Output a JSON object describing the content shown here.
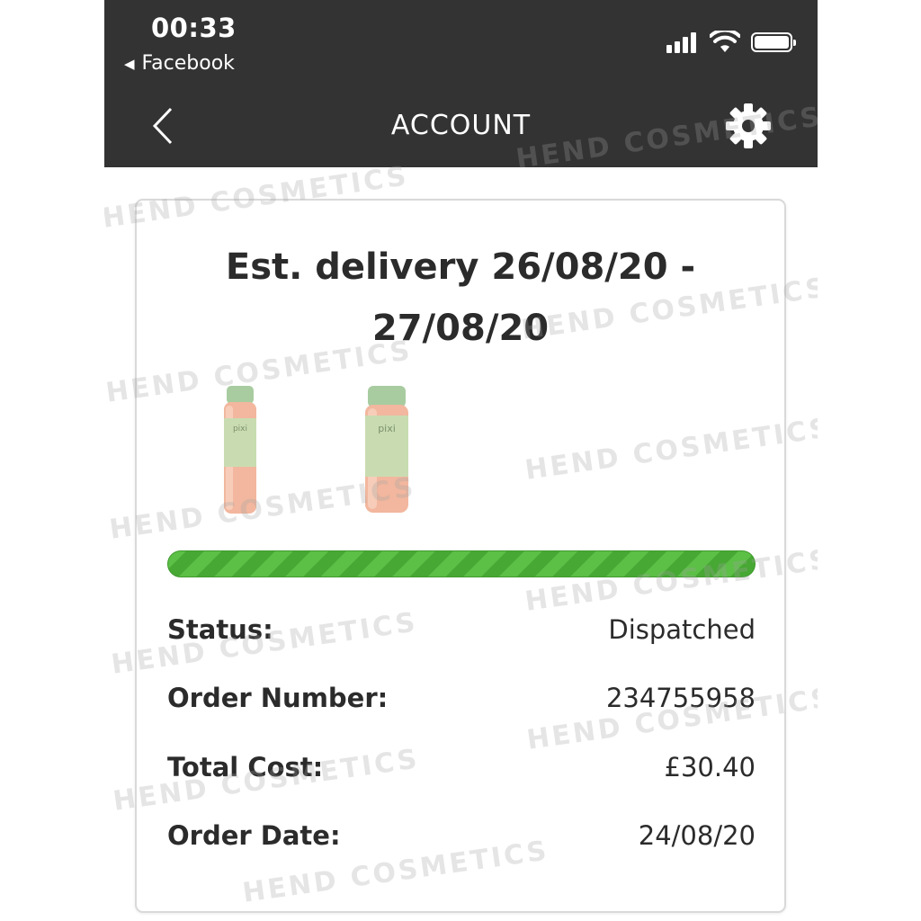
{
  "status_bar": {
    "time": "00:33",
    "back_app": "Facebook"
  },
  "nav": {
    "title": "ACCOUNT"
  },
  "order": {
    "delivery_line1": "Est. delivery 26/08/20 -",
    "delivery_line2": "27/08/20",
    "progress_fraction": 1.0,
    "details": [
      {
        "label": "Status:",
        "value": "Dispatched"
      },
      {
        "label": "Order Number:",
        "value": "234755958"
      },
      {
        "label": "Total Cost:",
        "value": "£30.40"
      },
      {
        "label": "Order Date:",
        "value": "24/08/20"
      }
    ],
    "product_brand": "pixi"
  },
  "watermark": "HEND COSMETICS",
  "colors": {
    "topbar": "#333333",
    "progress": "#5cbf46",
    "text": "#2b2b2b"
  },
  "icons": [
    "back-chevron-icon",
    "gear-icon",
    "signal-icon",
    "wifi-icon",
    "battery-icon"
  ]
}
